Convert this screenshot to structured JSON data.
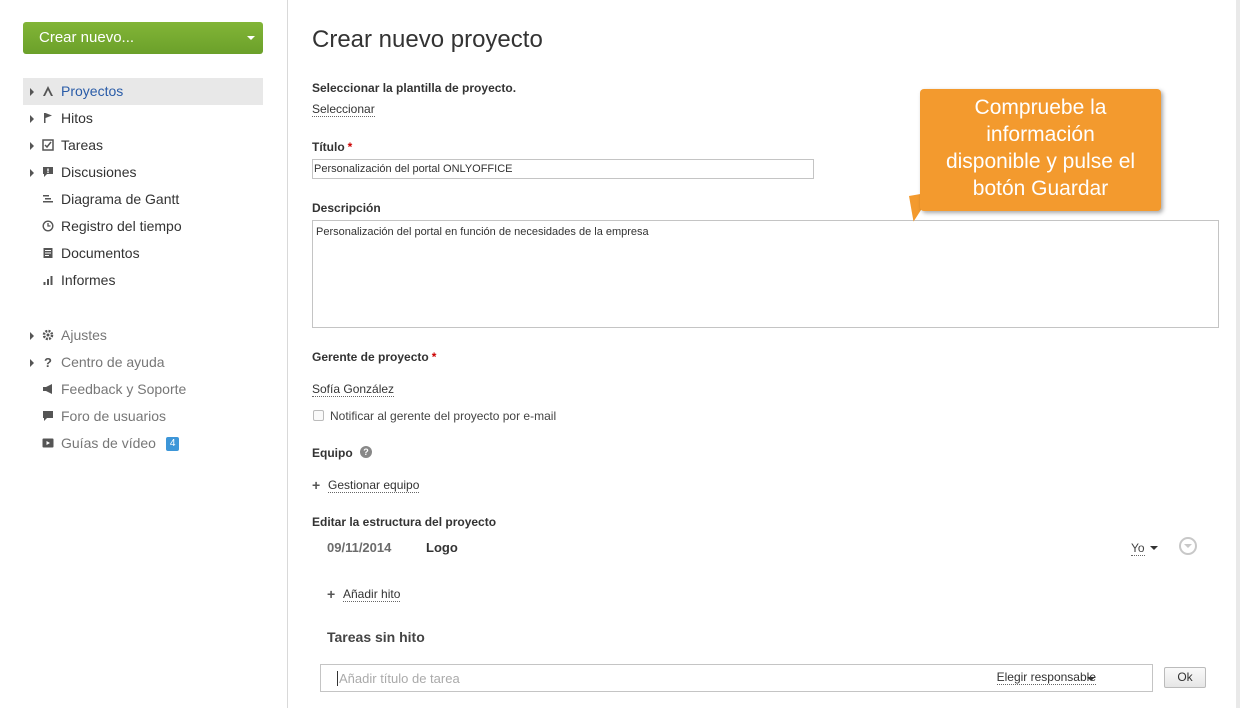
{
  "sidebar": {
    "create_button": "Crear nuevo...",
    "items": [
      {
        "label": "Proyectos",
        "icon": "projects-icon"
      },
      {
        "label": "Hitos",
        "icon": "flag-icon"
      },
      {
        "label": "Tareas",
        "icon": "task-checkbox-icon"
      },
      {
        "label": "Discusiones",
        "icon": "discussion-icon"
      },
      {
        "label": "Diagrama de Gantt",
        "icon": "gantt-icon"
      },
      {
        "label": "Registro del tiempo",
        "icon": "clock-icon"
      },
      {
        "label": "Documentos",
        "icon": "documents-icon"
      },
      {
        "label": "Informes",
        "icon": "reports-icon"
      }
    ],
    "secondary": [
      {
        "label": "Ajustes",
        "icon": "gear-icon"
      },
      {
        "label": "Centro de ayuda",
        "icon": "question-icon"
      },
      {
        "label": "Feedback y Soporte",
        "icon": "megaphone-icon"
      },
      {
        "label": "Foro de usuarios",
        "icon": "speech-bubble-icon"
      },
      {
        "label": "Guías de vídeo",
        "icon": "video-icon",
        "badge": "4"
      }
    ]
  },
  "form": {
    "title": "Crear nuevo proyecto",
    "template_label": "Seleccionar la plantilla de proyecto.",
    "template_link": "Seleccionar",
    "title_label": "Título",
    "required_mark": "*",
    "title_value": "Personalización del portal ONLYOFFICE",
    "description_label": "Descripción",
    "description_value": "Personalización del portal en función de necesidades de la empresa",
    "manager_label": "Gerente de proyecto",
    "manager_value": "Sofía González",
    "notify_label": "Notificar al gerente del proyecto por e-mail",
    "team_label": "Equipo",
    "manage_team": "Gestionar equipo",
    "structure_label": "Editar la estructura del proyecto",
    "milestone": {
      "date": "09/11/2014",
      "title": "Logo",
      "assignee": "Yo"
    },
    "add_milestone": "Añadir hito",
    "tasks_without_milestone": "Tareas sin hito",
    "task_placeholder": "Añadir título de tarea",
    "choose_responsible": "Elegir responsable",
    "ok_button": "Ok"
  },
  "callout": {
    "lines": [
      "Compruebe la",
      "información",
      "disponible y pulse el",
      "botón Guardar"
    ],
    "color": "#f39a2e"
  }
}
